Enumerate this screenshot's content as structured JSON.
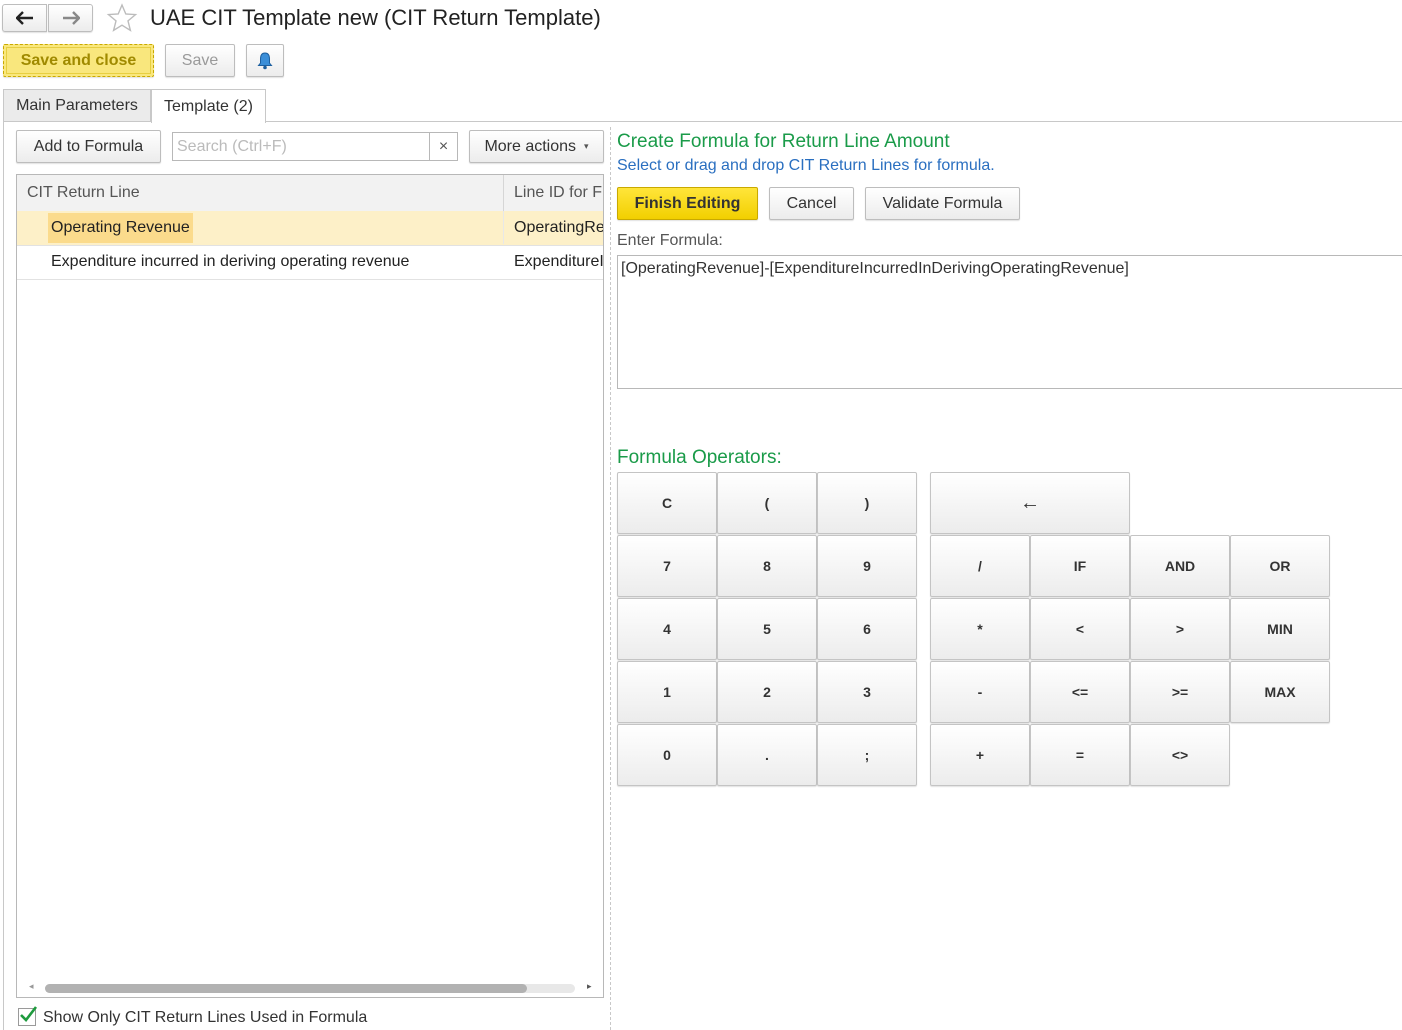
{
  "header": {
    "back_icon": "arrow-left-icon",
    "forward_icon": "arrow-right-icon",
    "favorite_icon": "star-icon",
    "title": "UAE CIT Template new (CIT Return Template)"
  },
  "toolbar": {
    "save_and_close": "Save and close",
    "save": "Save",
    "notify_icon": "bell-icon"
  },
  "tabs": [
    {
      "label": "Main Parameters"
    },
    {
      "label": "Template (2)"
    }
  ],
  "left_panel": {
    "add_to_formula": "Add to Formula",
    "search_placeholder": "Search (Ctrl+F)",
    "search_clear": "×",
    "more_actions": "More actions",
    "more_actions_arrow": "▾",
    "columns": [
      "CIT Return Line",
      "Line ID for F"
    ],
    "rows": [
      {
        "line": "Operating Revenue",
        "line_id": "OperatingRe"
      },
      {
        "line": "Expenditure incurred in deriving operating revenue",
        "line_id": "ExpenditureI"
      }
    ],
    "show_only_label": "Show Only CIT Return Lines Used in Formula",
    "show_only_checked": true
  },
  "right_panel": {
    "title": "Create Formula for Return Line Amount",
    "subtitle": "Select or drag and drop CIT Return Lines for formula.",
    "finish_editing": "Finish Editing",
    "cancel": "Cancel",
    "validate_formula": "Validate Formula",
    "enter_formula_label": "Enter Formula:",
    "formula": "[OperatingRevenue]-[ExpenditureIncurredInDerivingOperatingRevenue]",
    "operators_title": "Formula Operators:",
    "operators": {
      "clear": "C",
      "open_paren": "(",
      "close_paren": ")",
      "backspace": "←",
      "seven": "7",
      "eight": "8",
      "nine": "9",
      "divide": "/",
      "if": "IF",
      "and": "AND",
      "or": "OR",
      "four": "4",
      "five": "5",
      "six": "6",
      "multiply": "*",
      "less": "<",
      "greater": ">",
      "min": "MIN",
      "one": "1",
      "two": "2",
      "three": "3",
      "minus": "-",
      "less_equal": "<=",
      "greater_equal": ">=",
      "max": "MAX",
      "zero": "0",
      "dot": ".",
      "semicolon": ";",
      "plus": "+",
      "equal": "=",
      "not_equal": "<>"
    }
  },
  "colors": {
    "accent_yellow": "#f2cf00",
    "heading_green": "#1a9b49",
    "link_blue": "#2a6fc0",
    "selected_row": "#fdf0c8"
  }
}
